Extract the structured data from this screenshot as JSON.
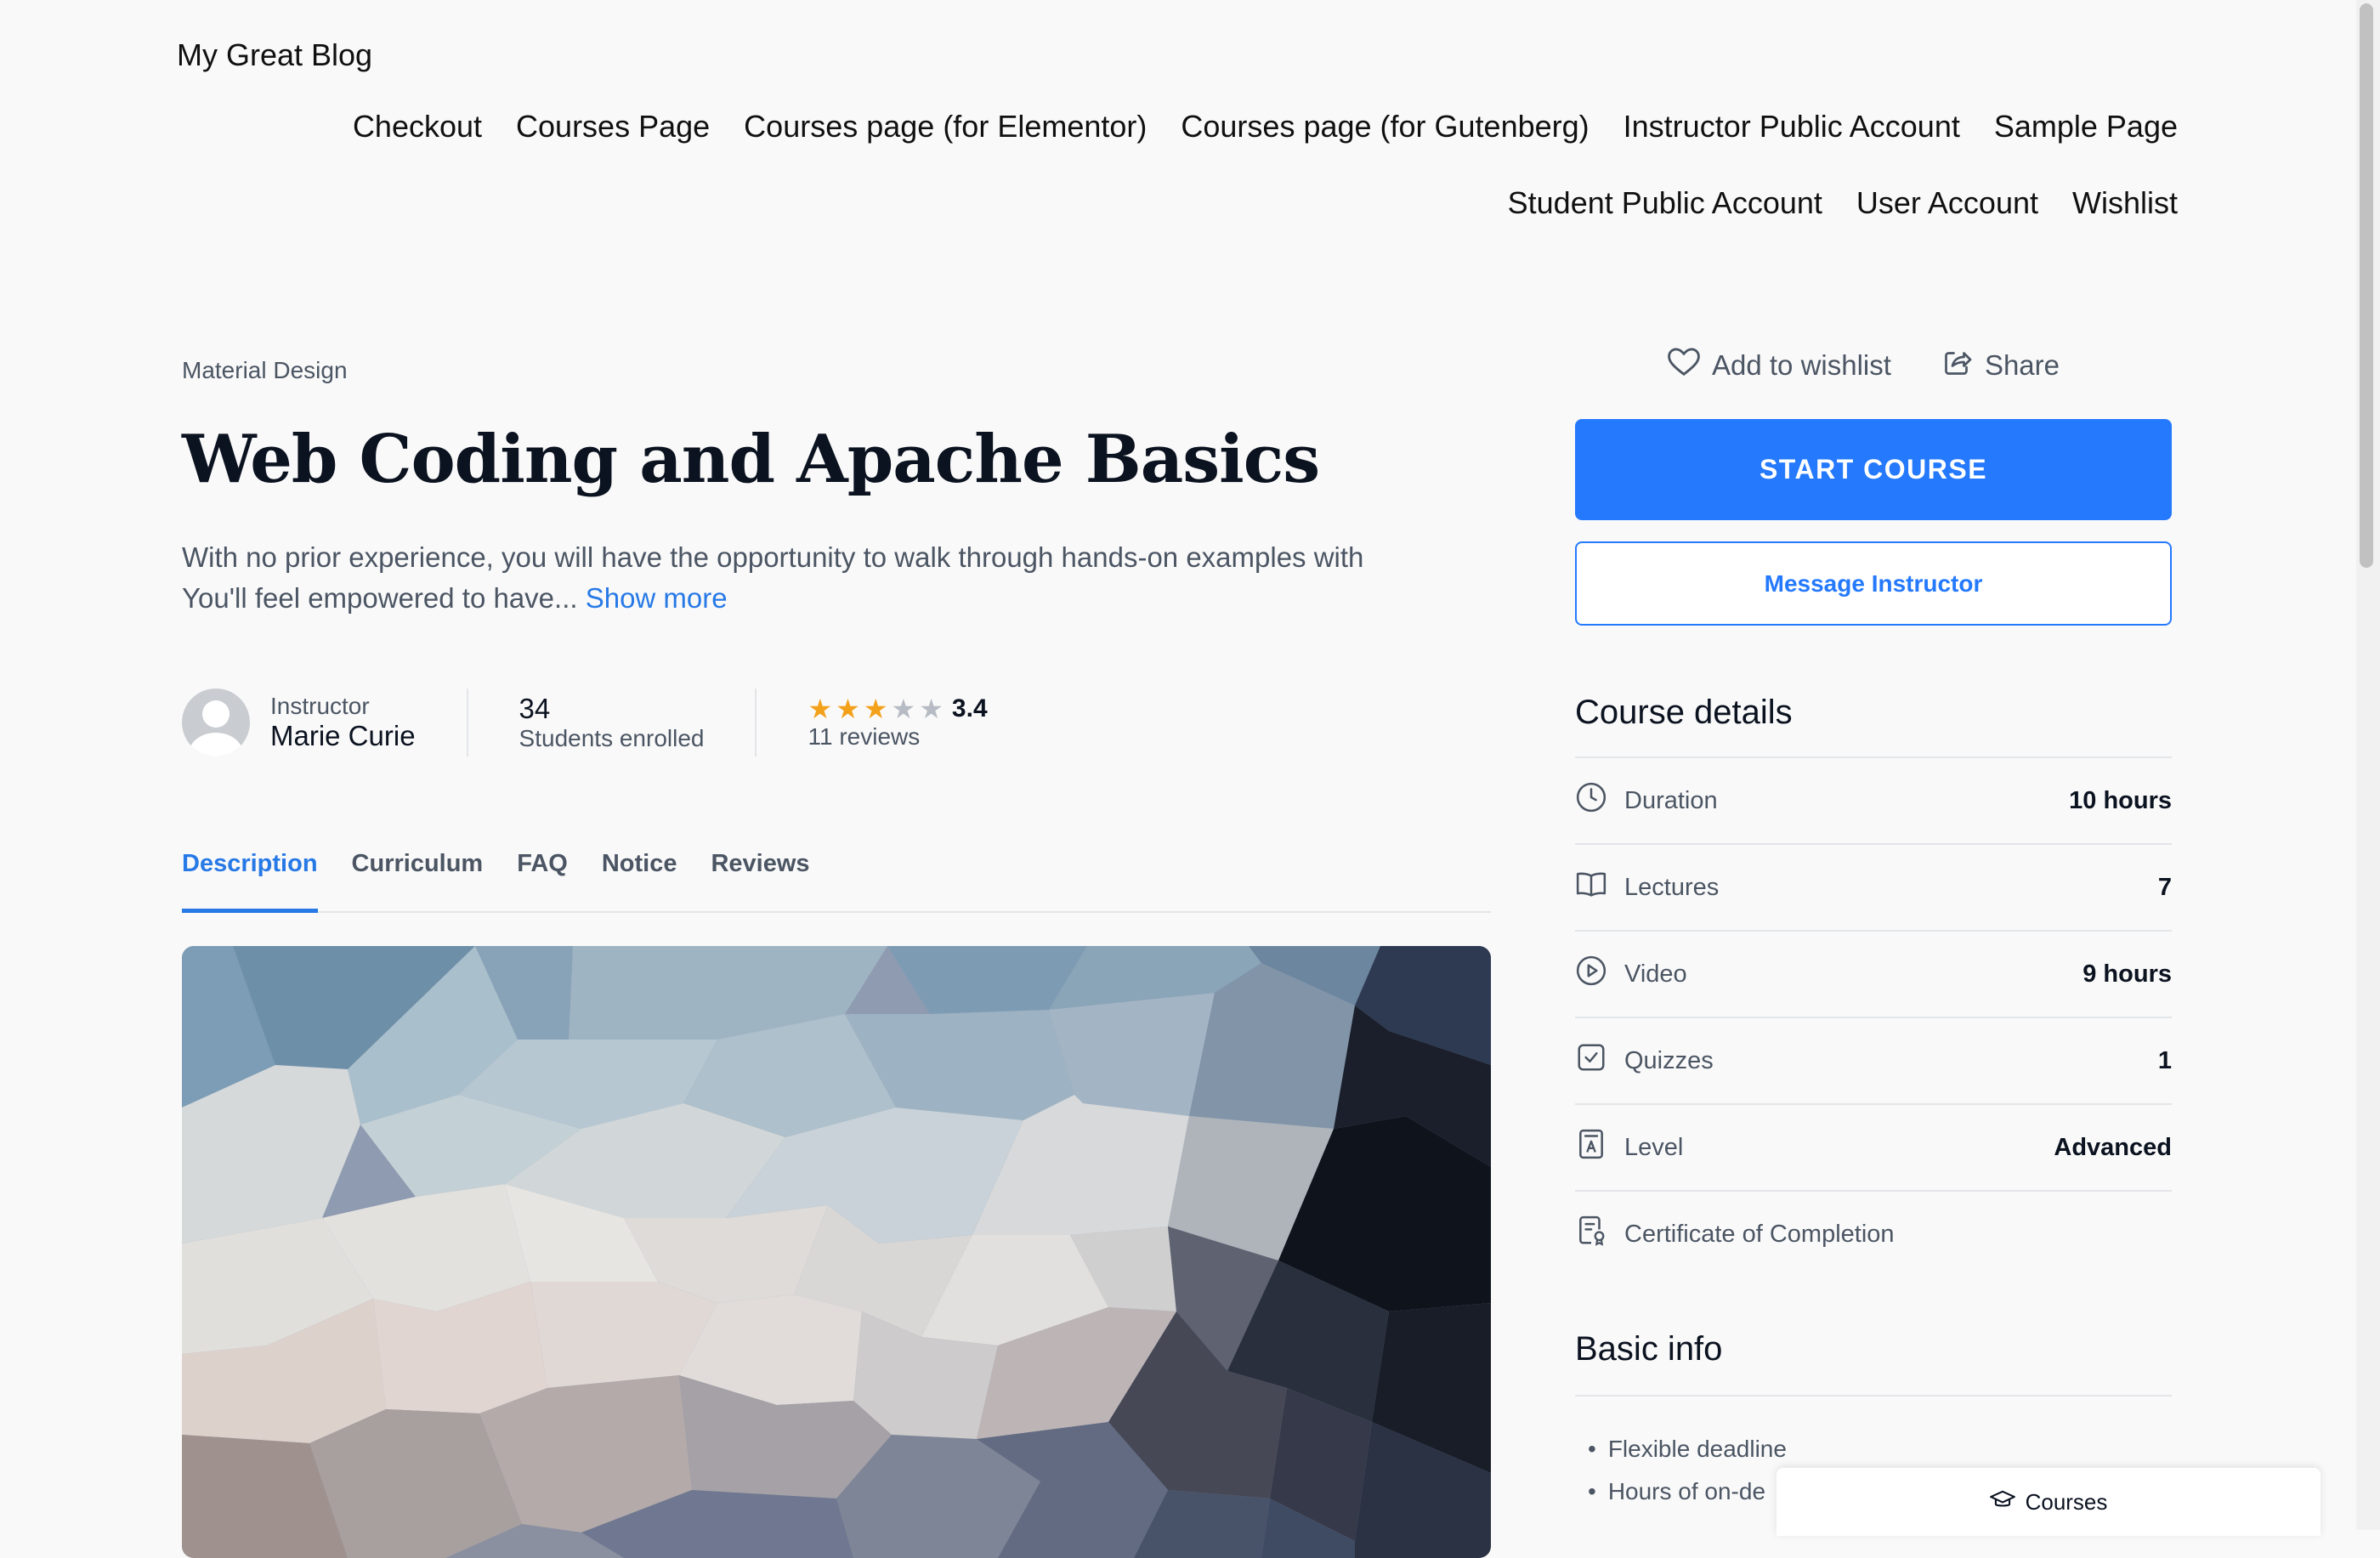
{
  "site": {
    "title": "My Great Blog"
  },
  "nav": {
    "items": [
      "Checkout",
      "Courses Page",
      "Courses page (for Elementor)",
      "Courses page (for Gutenberg)",
      "Instructor Public Account",
      "Sample Page",
      "Student Public Account",
      "User Account",
      "Wishlist"
    ]
  },
  "course": {
    "category": "Material Design",
    "title": "Web Coding and Apache Basics",
    "excerpt_line1": "With no prior experience, you will have the opportunity to walk through hands-on examples with",
    "excerpt_line2": "You'll feel empowered to have...",
    "show_more": "Show more"
  },
  "meta": {
    "instructor_label": "Instructor",
    "instructor_name": "Marie Curie",
    "students_count": "34",
    "students_label": "Students enrolled",
    "rating": "3.4",
    "rating_value": 3.4,
    "stars_filled": 3,
    "stars_total": 5,
    "reviews": "11 reviews",
    "star_color": "#f3a11b"
  },
  "tabs": [
    {
      "label": "Description",
      "active": true
    },
    {
      "label": "Curriculum",
      "active": false
    },
    {
      "label": "FAQ",
      "active": false
    },
    {
      "label": "Notice",
      "active": false
    },
    {
      "label": "Reviews",
      "active": false
    }
  ],
  "sidebar": {
    "wishlist_label": "Add to wishlist",
    "share_label": "Share",
    "start_label": "START COURSE",
    "message_label": "Message Instructor",
    "details_title": "Course details",
    "details": [
      {
        "icon": "clock-icon",
        "label": "Duration",
        "value": "10 hours"
      },
      {
        "icon": "book-icon",
        "label": "Lectures",
        "value": "7"
      },
      {
        "icon": "play-circle-icon",
        "label": "Video",
        "value": "9 hours"
      },
      {
        "icon": "checkbox-icon",
        "label": "Quizzes",
        "value": "1"
      },
      {
        "icon": "level-icon",
        "label": "Level",
        "value": "Advanced"
      },
      {
        "icon": "certificate-icon",
        "label": "Certificate of Completion",
        "value": ""
      }
    ],
    "basic_title": "Basic info",
    "basic_items": [
      "Flexible deadline",
      "Hours of on-de"
    ]
  },
  "floating": {
    "courses_label": "Courses"
  },
  "colors": {
    "accent": "#2479fd",
    "link": "#2779e6",
    "text": "#0b1220",
    "muted": "#4b5563",
    "background": "#f9f9f9"
  }
}
